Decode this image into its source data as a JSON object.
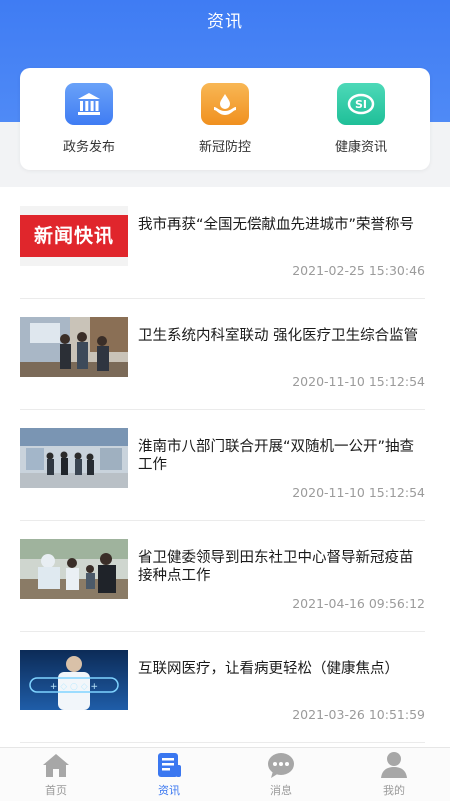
{
  "header": {
    "title": "资讯"
  },
  "quick_links": [
    {
      "label": "政务发布",
      "icon": "government-building-icon",
      "color": "#4a86f3"
    },
    {
      "label": "新冠防控",
      "icon": "hand-drop-icon",
      "color": "#f4a23b"
    },
    {
      "label": "健康资讯",
      "icon": "social-security-icon",
      "color": "#2fc8a4"
    }
  ],
  "news": [
    {
      "thumb_text": "新闻快讯",
      "title": "我市再获“全国无偿献血先进城市”荣誉称号",
      "time": "2021-02-25 15:30:46"
    },
    {
      "title": "卫生系统内科室联动 强化医疗卫生综合监管",
      "time": "2020-11-10 15:12:54"
    },
    {
      "title": "淮南市八部门联合开展“双随机一公开”抽查工作",
      "time": "2020-11-10 15:12:54"
    },
    {
      "title": "省卫健委领导到田东社卫中心督导新冠疫苗接种点工作",
      "time": "2021-04-16 09:56:12"
    },
    {
      "title": "互联网医疗，让看病更轻松（健康焦点）",
      "time": "2021-03-26 10:51:59"
    }
  ],
  "tabs": [
    {
      "label": "首页",
      "icon": "home-icon"
    },
    {
      "label": "资讯",
      "icon": "news-icon",
      "active": true
    },
    {
      "label": "消息",
      "icon": "chat-bubble-icon"
    },
    {
      "label": "我的",
      "icon": "user-icon"
    }
  ],
  "colors": {
    "primary": "#3a77f0",
    "thumb_red": "#e0262c"
  }
}
